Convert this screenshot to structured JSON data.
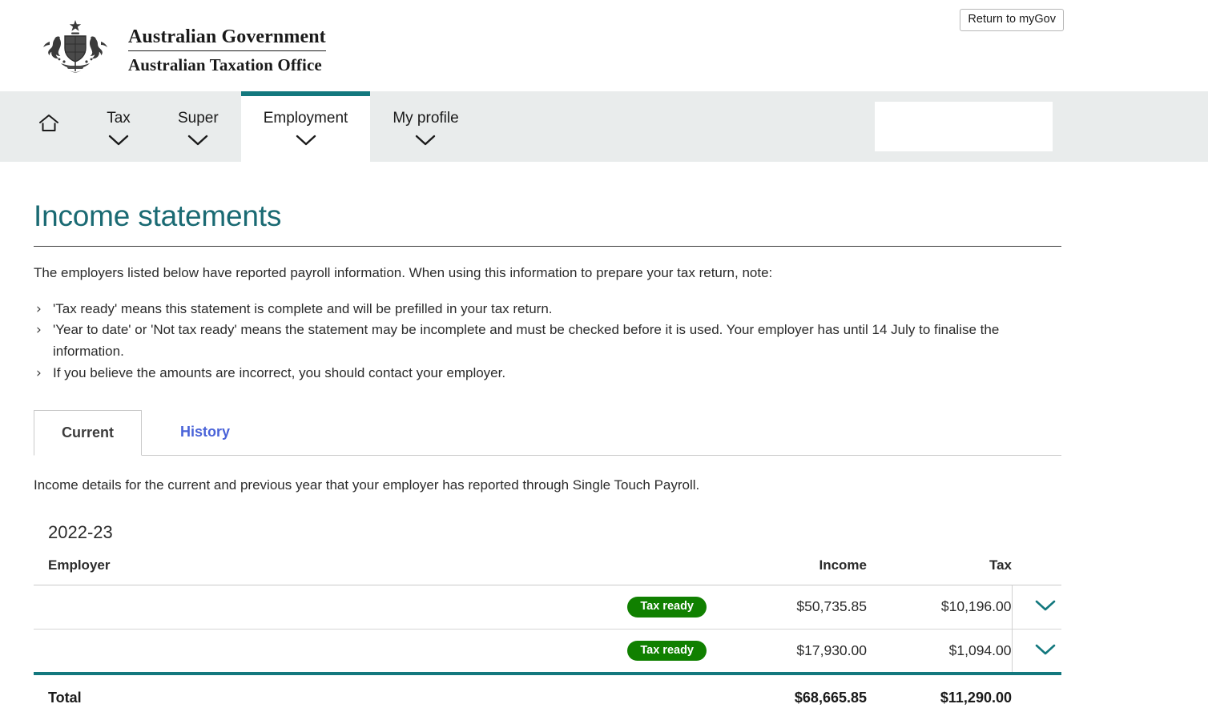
{
  "header": {
    "logo_alt": "Australian Coat of Arms",
    "brand_line1": "Australian Government",
    "brand_line2": "Australian Taxation Office",
    "mygov_button": "Return to myGov"
  },
  "nav": {
    "items": [
      {
        "label": "",
        "icon": "home-icon",
        "has_chevron": false,
        "active": false,
        "name": "home"
      },
      {
        "label": "Tax",
        "icon": "chevron-down-icon",
        "has_chevron": true,
        "active": false,
        "name": "tax"
      },
      {
        "label": "Super",
        "icon": "chevron-down-icon",
        "has_chevron": true,
        "active": false,
        "name": "super"
      },
      {
        "label": "Employment",
        "icon": "chevron-down-icon",
        "has_chevron": true,
        "active": true,
        "name": "employment"
      },
      {
        "label": "My profile",
        "icon": "chevron-down-icon",
        "has_chevron": true,
        "active": false,
        "name": "my-profile"
      }
    ]
  },
  "page": {
    "title": "Income statements",
    "intro": "The employers listed below have reported payroll information. When using this information to prepare your tax return, note:",
    "bullets": [
      "'Tax ready' means this statement is complete and will be prefilled in your tax return.",
      "'Year to date' or 'Not tax ready' means the statement may be incomplete and must be checked before it is used. Your employer has until 14 July to finalise the information.",
      "If you believe the amounts are incorrect, you should contact your employer."
    ]
  },
  "tabs": {
    "current": "Current",
    "history": "History",
    "description": "Income details for the current and previous year that your employer has reported through Single Touch Payroll."
  },
  "table": {
    "year": "2022-23",
    "headers": {
      "employer": "Employer",
      "income": "Income",
      "tax": "Tax"
    },
    "rows": [
      {
        "employer": "",
        "status": "Tax ready",
        "income": "$50,735.85",
        "tax": "$10,196.00"
      },
      {
        "employer": "",
        "status": "Tax ready",
        "income": "$17,930.00",
        "tax": "$1,094.00"
      }
    ],
    "total": {
      "label": "Total",
      "income": "$68,665.85",
      "tax": "$11,290.00"
    }
  },
  "colors": {
    "teal": "#13787e",
    "title_teal": "#1a6a73",
    "badge_green": "#108000",
    "nav_background": "#e9ecec",
    "link_blue": "#4a63d8"
  }
}
